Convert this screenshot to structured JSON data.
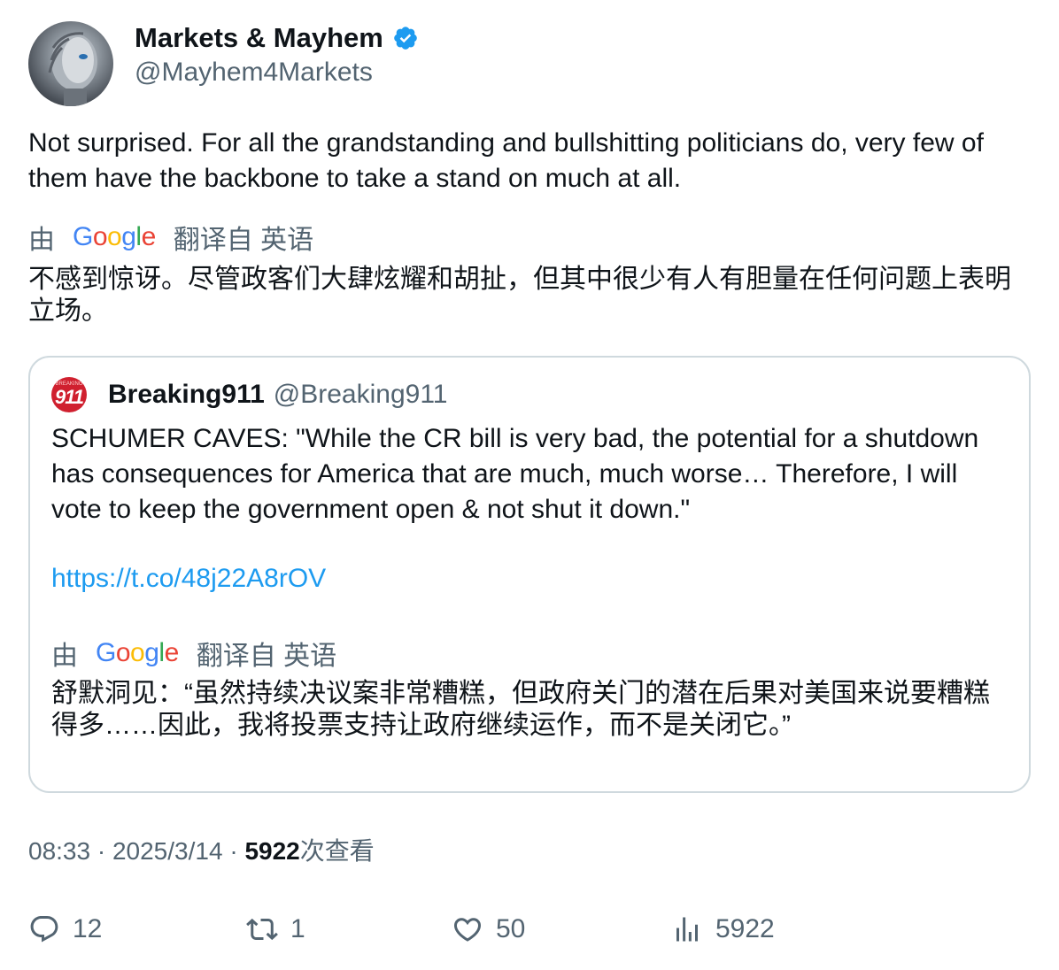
{
  "author": {
    "display_name": "Markets & Mayhem",
    "handle": "@Mayhem4Markets",
    "verified_color": "#1d9bf0"
  },
  "tweet": {
    "text": "Not surprised. For all the grandstanding and bullshitting politicians do, very few of them have the backbone to take a stand on much at all.",
    "translation_prefix": "由",
    "translation_provider": "Google",
    "translation_suffix": "翻译自 英语",
    "translated_text": "不感到惊讶。尽管政客们大肆炫耀和胡扯，但其中很少有人有胆量在任何问题上表明立场。"
  },
  "quote": {
    "avatar_text": "911",
    "avatar_top_text": "BREAKING",
    "name": "Breaking911",
    "handle": "@Breaking911",
    "text": "SCHUMER CAVES: \"While the CR bill is very bad, the potential for a shutdown has consequences for America that are much, much worse… Therefore, I will vote to keep the government open & not shut it down.\"",
    "link": "https://t.co/48j22A8rOV",
    "translation_prefix": "由",
    "translation_provider": "Google",
    "translation_suffix": "翻译自 英语",
    "translated_text": "舒默洞见：“虽然持续决议案非常糟糕，但政府关门的潜在后果对美国来说要糟糕得多……因此，我将投票支持让政府继续运作，而不是关闭它。”"
  },
  "meta": {
    "time": "08:33",
    "separator": " · ",
    "date": "2025/3/14",
    "views_count": "5922",
    "views_label": "次查看"
  },
  "actions": {
    "replies": "12",
    "retweets": "1",
    "likes": "50",
    "views": "5922"
  }
}
